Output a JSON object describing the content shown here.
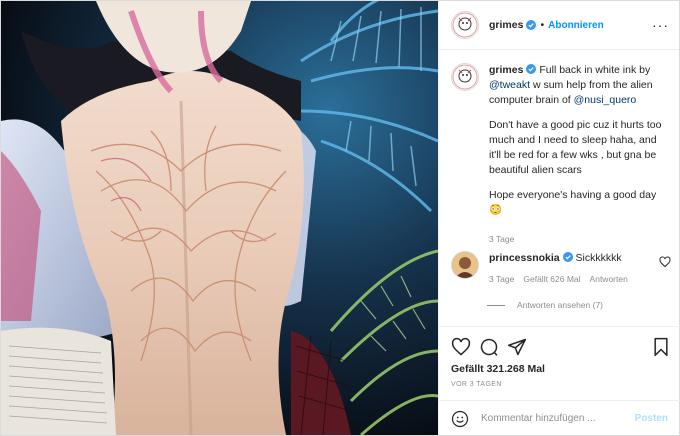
{
  "post": {
    "username": "grimes",
    "follow_label": "Abonnieren",
    "dot": "•",
    "more_label": "···"
  },
  "caption": {
    "username": "grimes",
    "line1_pre": "Full back in white ink by",
    "mention1": "@tweakt",
    "line1_mid": "w sum help from the alien computer brain of",
    "mention2": "@nusi_quero",
    "para2": "Don't have a good pic cuz it hurts too much and I need to sleep haha, and it'll be red for a few wks , but gna be beautiful alien scars",
    "para3": "Hope everyone's having a good day",
    "emoji": "😳",
    "time": "3 Tage"
  },
  "comment": {
    "username": "princessnokia",
    "text": "Sickkkkkk",
    "time": "3 Tage",
    "likes": "Gefällt 626 Mal",
    "reply_label": "Antworten",
    "view_replies": "Antworten ansehen (7)"
  },
  "stats": {
    "likes": "Gefällt 321.268 Mal",
    "ago": "VOR 3 TAGEN"
  },
  "add_comment": {
    "placeholder": "Kommentar hinzufügen ...",
    "post_label": "Posten"
  },
  "colors": {
    "accent": "#0095f6",
    "verified": "#3897f0",
    "muted": "#8e8e8e"
  },
  "icons": [
    "verified-icon",
    "more-options-icon",
    "heart-icon",
    "comment-icon",
    "share-icon",
    "bookmark-icon",
    "emoji-icon",
    "small-heart-icon"
  ]
}
